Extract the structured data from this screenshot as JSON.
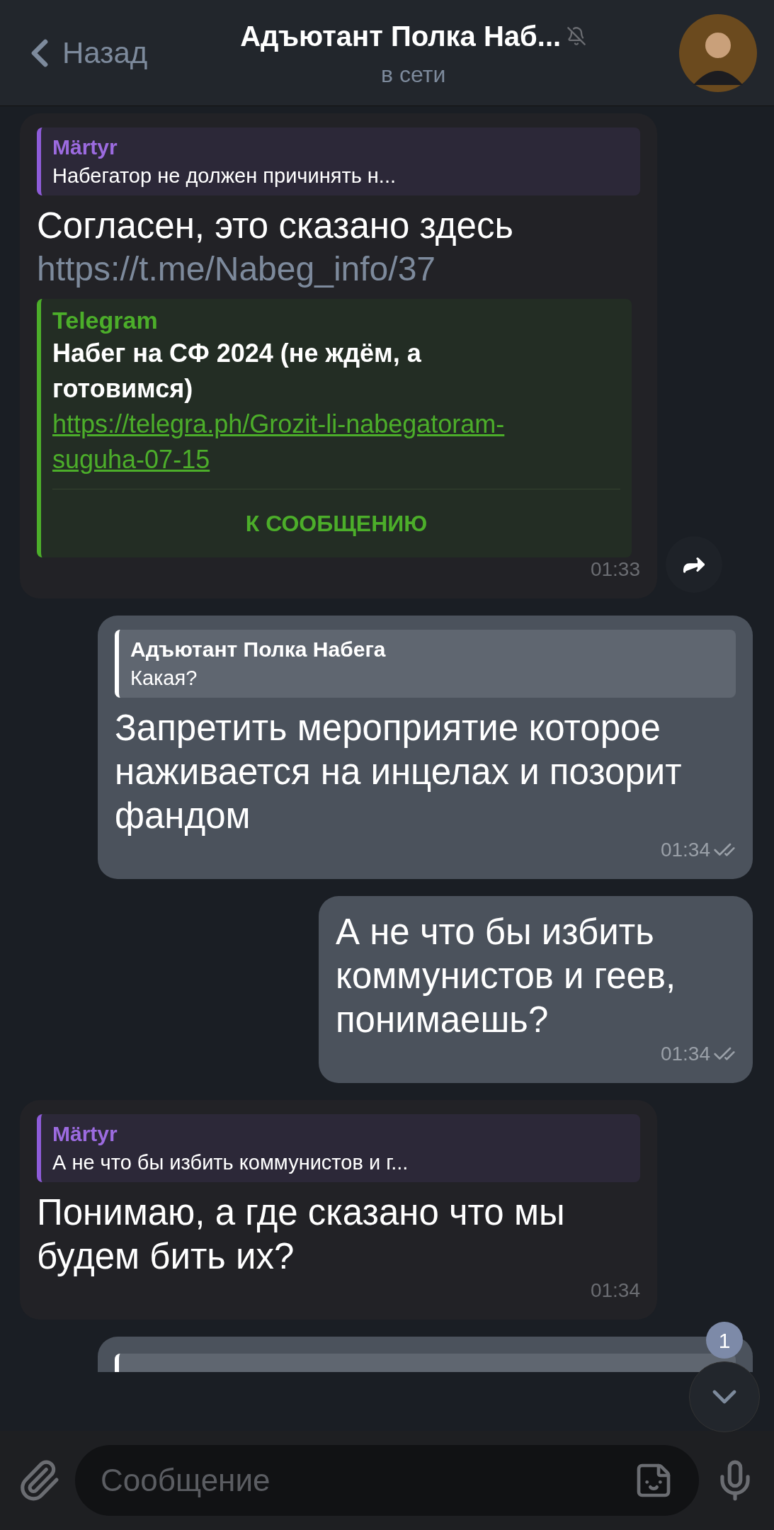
{
  "header": {
    "back_label": "Назад",
    "title": "Адъютант Полка Наб...",
    "status": "в сети",
    "muted": true
  },
  "messages": [
    {
      "kind": "incoming",
      "reply": {
        "author": "Märtyr",
        "text": "Набегатор не должен причинять н..."
      },
      "text": "Согласен, это сказано здесь",
      "link": "https://t.me/Nabeg_info/37",
      "preview": {
        "site": "Telegram",
        "title": "Набег на СФ 2024 (не ждём, а готовимся)",
        "url": "https://telegra.ph/Grozit-li-nabegatoram-suguha-07-15",
        "button": "К СООБЩЕНИЮ"
      },
      "time": "01:33",
      "forward": true
    },
    {
      "kind": "outgoing",
      "reply": {
        "author": "Адъютант Полка Набега",
        "text": "Какая?"
      },
      "text": "Запретить мероприятие которое наживается на инцелах и позорит фандом",
      "time": "01:34",
      "read": true
    },
    {
      "kind": "outgoing",
      "text": "А не что бы избить коммунистов и геев, понимаешь?",
      "time": "01:34",
      "read": true
    },
    {
      "kind": "incoming",
      "reply": {
        "author": "Märtyr",
        "text": "А не что бы избить коммунистов и г..."
      },
      "text": "Понимаю, а где сказано что мы будем бить их?",
      "time": "01:34"
    },
    {
      "kind": "partial"
    }
  ],
  "scroll_down": {
    "badge": "1"
  },
  "input": {
    "placeholder": "Сообщение"
  }
}
